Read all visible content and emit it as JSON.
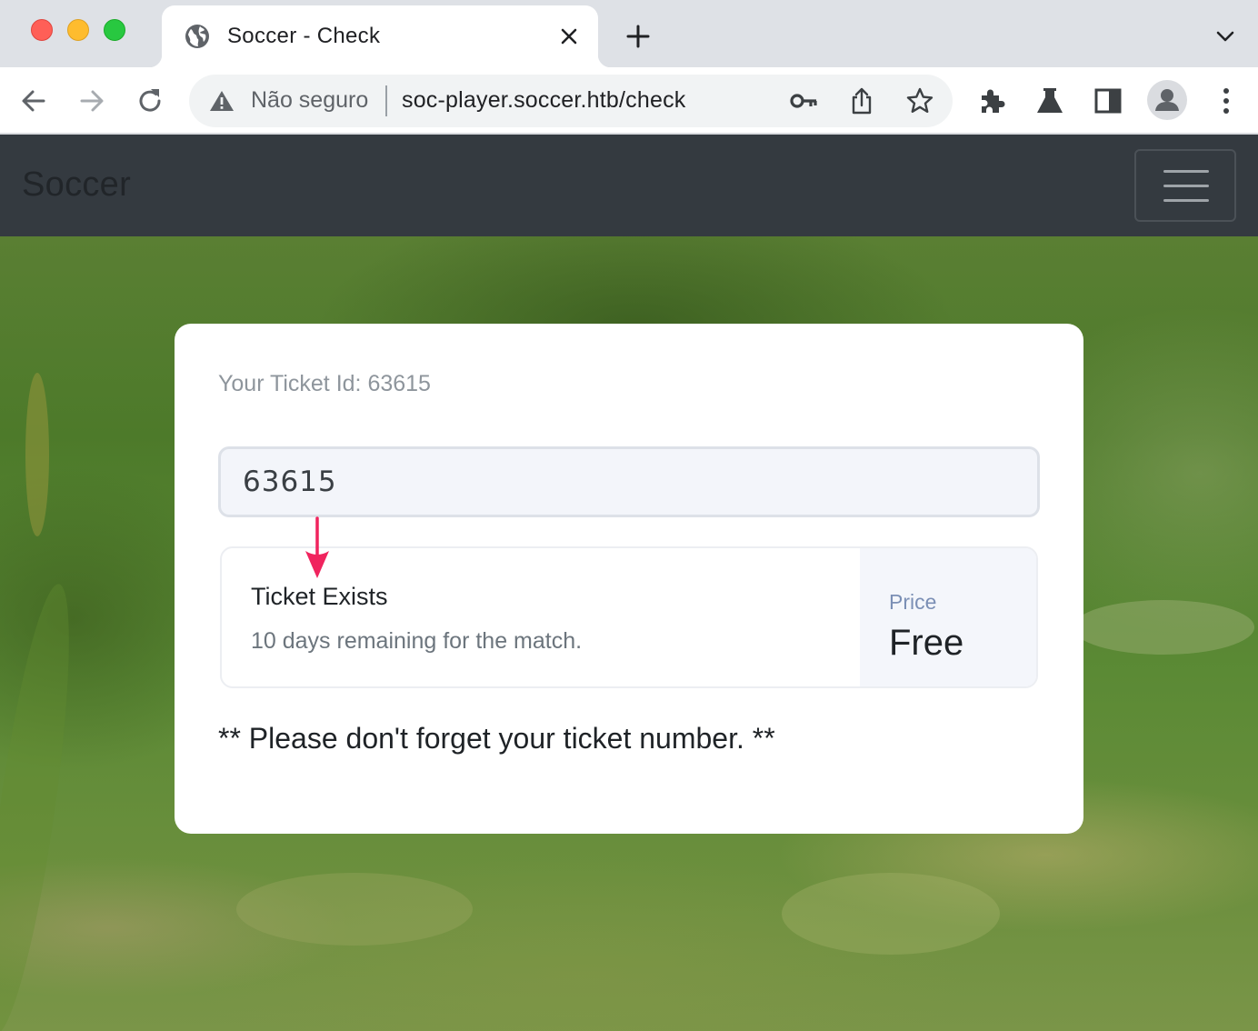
{
  "browser": {
    "tab": {
      "title": "Soccer - Check",
      "favicon": "globe-icon"
    },
    "address_bar": {
      "security_label": "Não seguro",
      "url": "soc-player.soccer.htb/check"
    },
    "icons": [
      "back-icon",
      "forward-icon",
      "reload-icon",
      "warning-icon",
      "key-icon",
      "share-icon",
      "star-icon",
      "extensions-icon",
      "labs-icon",
      "side-panel-icon",
      "profile-icon",
      "menu-icon"
    ]
  },
  "navbar": {
    "brand": "Soccer",
    "toggler_icon": "hamburger-icon"
  },
  "card": {
    "ticket_id_text": "Your Ticket Id: 63615",
    "input": {
      "value": "63615"
    },
    "result": {
      "title": "Ticket Exists",
      "description": "10 days remaining for the match.",
      "price_label": "Price",
      "price_value": "Free"
    },
    "reminder": "** Please don't forget your ticket number. **"
  },
  "colors": {
    "navbar_bg": "#343a40",
    "annotation_arrow": "#f0245e",
    "price_label": "#7b8fb5",
    "omnibox_bg": "#f1f3f4"
  }
}
